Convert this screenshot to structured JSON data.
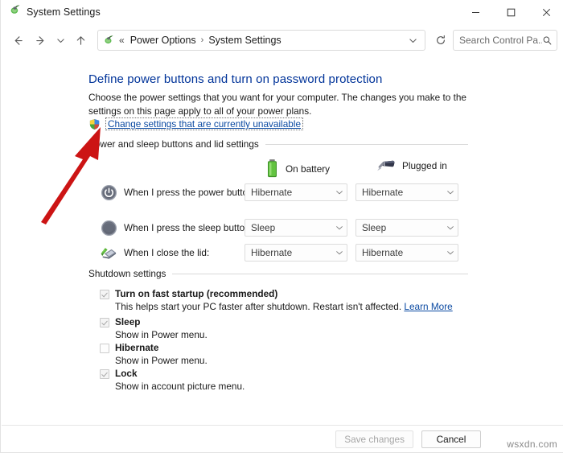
{
  "window": {
    "title": "System Settings",
    "app_icon": "control-panel-icon",
    "controls": {
      "minimize": "minimize-icon",
      "maximize": "maximize-icon",
      "close": "close-icon"
    }
  },
  "navbar": {
    "back": "back-arrow-icon",
    "forward": "forward-arrow-icon",
    "recent": "chevron-down-icon",
    "up": "up-arrow-icon",
    "breadcrumb": {
      "icon": "control-panel-icon",
      "overflow": "«",
      "items": [
        "Power Options",
        "System Settings"
      ],
      "separator": "›"
    },
    "dropdown": "chevron-down-icon",
    "refresh": "refresh-icon"
  },
  "search": {
    "placeholder": "Search Control Pa...",
    "icon": "search-icon"
  },
  "page": {
    "heading": "Define power buttons and turn on password protection",
    "description": "Choose the power settings that you want for your computer. The changes you make to the settings on this page apply to all of your power plans.",
    "uac_shield_icon": "shield-icon",
    "uac_link": "Change settings that are currently unavailable"
  },
  "sections": {
    "power": {
      "title": "Power and sleep buttons and lid settings",
      "columns": [
        {
          "label": "On battery",
          "icon": "battery-icon"
        },
        {
          "label": "Plugged in",
          "icon": "power-plug-icon"
        }
      ],
      "rows": [
        {
          "icon": "power-button-icon",
          "label": "When I press the power button:",
          "on_battery": "Hibernate",
          "plugged_in": "Hibernate"
        },
        {
          "icon": "sleep-button-icon",
          "label": "When I press the sleep button:",
          "on_battery": "Sleep",
          "plugged_in": "Sleep"
        },
        {
          "icon": "laptop-lid-icon",
          "label": "When I close the lid:",
          "on_battery": "Hibernate",
          "plugged_in": "Hibernate"
        }
      ]
    },
    "shutdown": {
      "title": "Shutdown settings",
      "items": [
        {
          "label": "Turn on fast startup (recommended)",
          "checked": true,
          "description": "This helps start your PC faster after shutdown. Restart isn't affected.",
          "link": "Learn More"
        },
        {
          "label": "Sleep",
          "checked": true,
          "description": "Show in Power menu.",
          "link": ""
        },
        {
          "label": "Hibernate",
          "checked": false,
          "description": "Show in Power menu.",
          "link": ""
        },
        {
          "label": "Lock",
          "checked": true,
          "description": "Show in account picture menu.",
          "link": ""
        }
      ]
    }
  },
  "footer": {
    "save_label": "Save changes",
    "save_disabled": true,
    "cancel_label": "Cancel"
  },
  "watermark": "wsxdn.com",
  "annotation": {
    "type": "arrow",
    "color": "#cc1414",
    "points_to": "uac-link"
  },
  "colors": {
    "heading": "#003399",
    "link": "#0b4aa2",
    "annotation": "#cc1414",
    "battery": "#4caf2a"
  }
}
